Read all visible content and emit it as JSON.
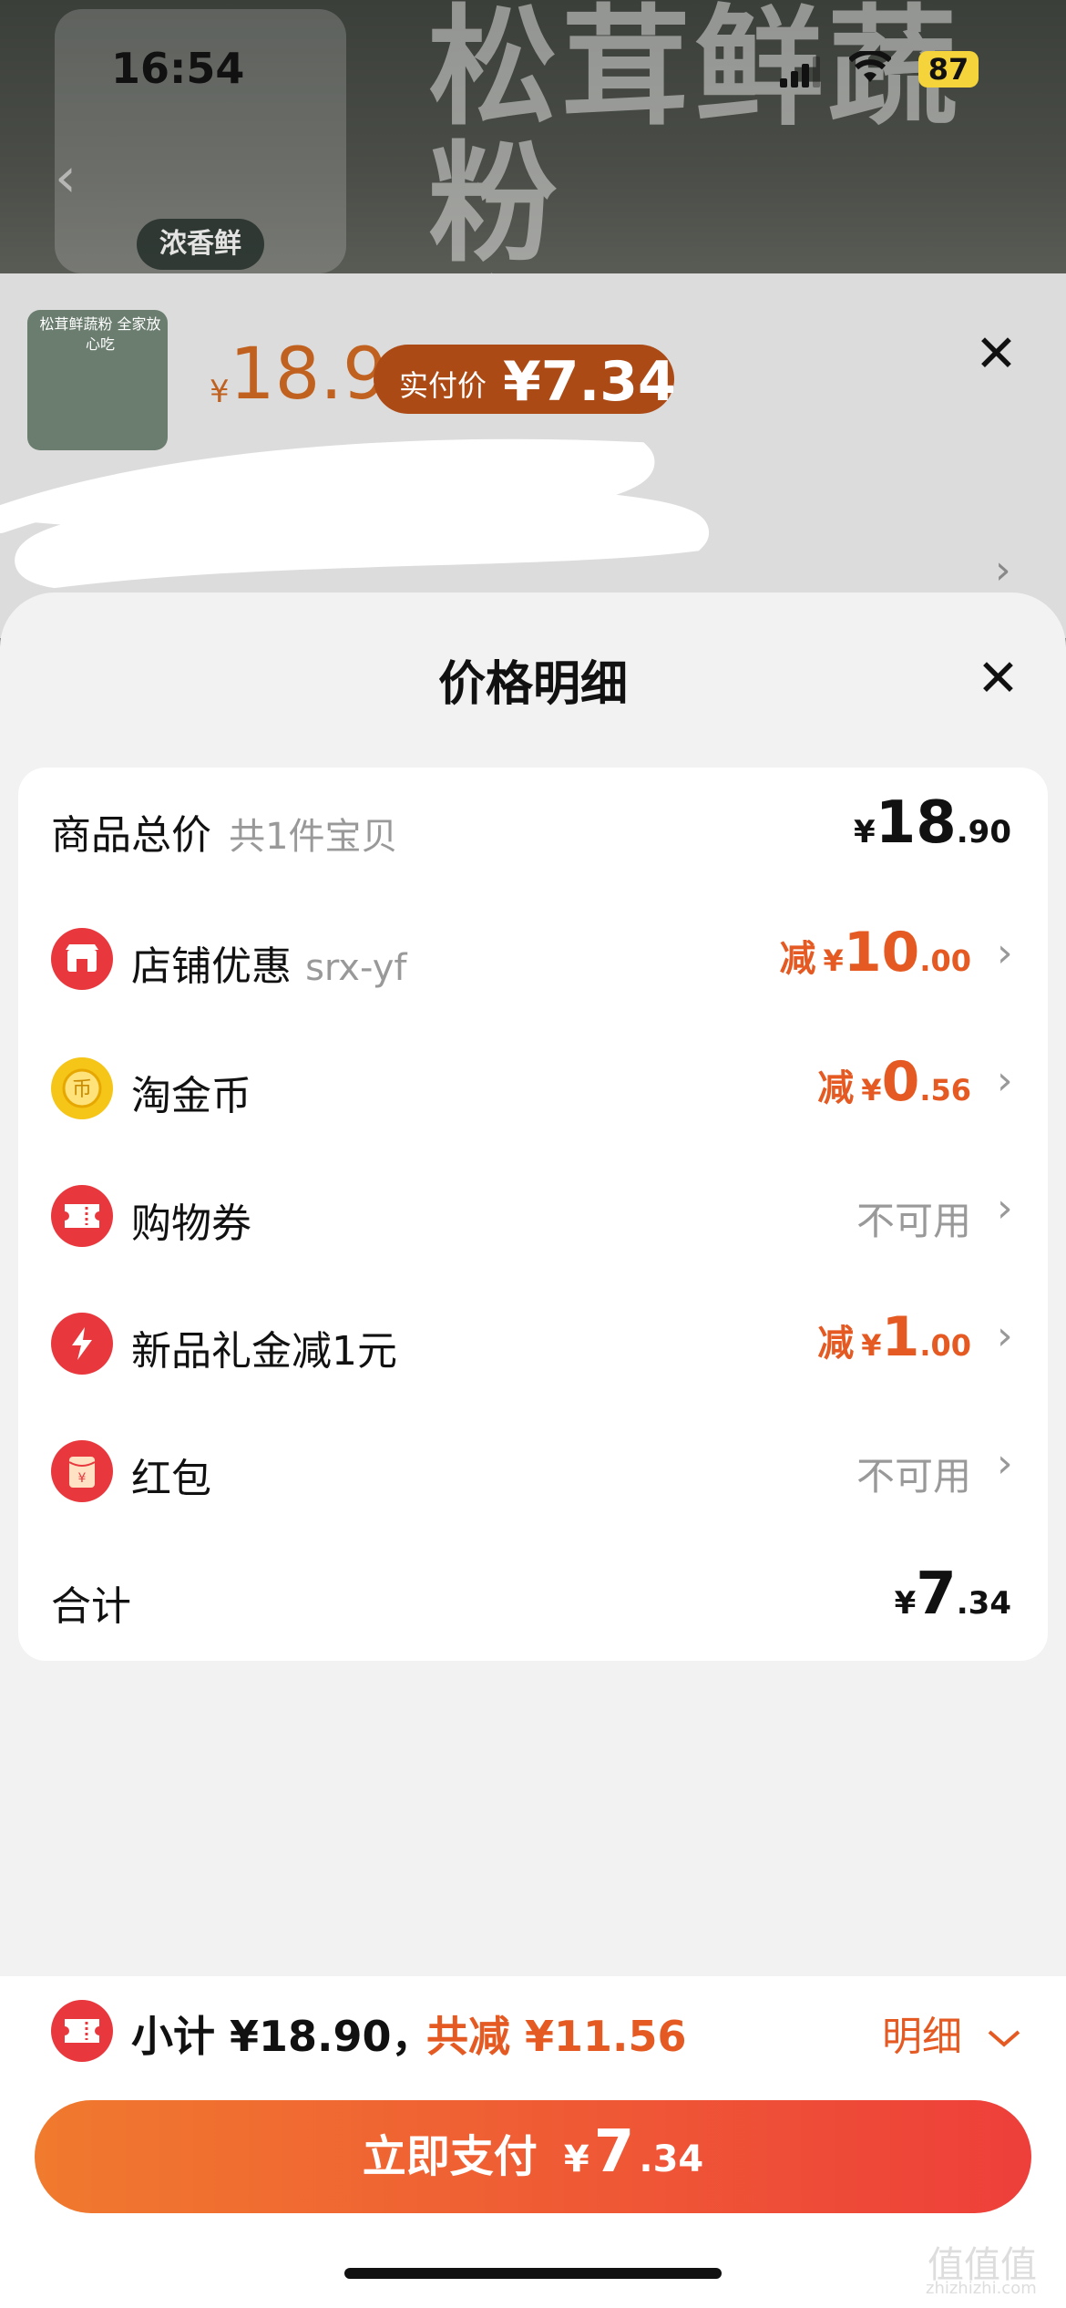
{
  "status": {
    "time": "16:54",
    "battery": "87"
  },
  "banner": {
    "title": "松茸鲜蔬粉\n全家放心吃",
    "jar_label": "浓香鲜"
  },
  "product": {
    "thumb_text": "松茸鲜蔬粉 全家放心吃",
    "price_yen": "¥",
    "price": "18.9",
    "paid_label": "实付价",
    "paid_value": "¥7.34"
  },
  "modal": {
    "title": "价格明细",
    "rows": [
      {
        "label": "商品总价",
        "sub": "共1件宝贝",
        "prefix": "",
        "yen": "¥",
        "int": "18",
        "dec": ".90",
        "status": ""
      },
      {
        "label": "店铺优惠",
        "sub": "srx-yf",
        "prefix": "减",
        "yen": "¥",
        "int": "10",
        "dec": ".00",
        "status": ""
      },
      {
        "label": "淘金币",
        "sub": "",
        "prefix": "减",
        "yen": "¥",
        "int": "0",
        "dec": ".56",
        "status": ""
      },
      {
        "label": "购物券",
        "sub": "",
        "prefix": "",
        "yen": "",
        "int": "",
        "dec": "",
        "status": "不可用"
      },
      {
        "label": "新品礼金减1元",
        "sub": "",
        "prefix": "减",
        "yen": "¥",
        "int": "1",
        "dec": ".00",
        "status": ""
      },
      {
        "label": "红包",
        "sub": "",
        "prefix": "",
        "yen": "",
        "int": "",
        "dec": "",
        "status": "不可用"
      },
      {
        "label": "合计",
        "sub": "",
        "prefix": "",
        "yen": "¥",
        "int": "7",
        "dec": ".34",
        "status": ""
      }
    ]
  },
  "footer": {
    "subtotal": "小计 ¥18.90，",
    "discount": "共减 ¥11.56",
    "detail": "明细",
    "pay_label": "立即支付",
    "pay_yen": "¥",
    "pay_int": "7",
    "pay_dec": ".34"
  },
  "watermark": {
    "glyph": "值值值",
    "site": "zhizhizhi.com"
  },
  "colors": {
    "accent": "#e55a22",
    "pay_start": "#f07a2e",
    "pay_end": "#ee3f3a",
    "icon_red": "#e8383d"
  }
}
